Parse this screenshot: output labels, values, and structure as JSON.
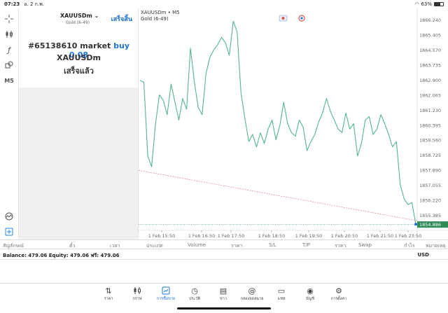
{
  "status": {
    "time": "07:23",
    "date": "อ. 2 ก.พ.",
    "battery": "63%",
    "battery_level": 0.63
  },
  "panel": {
    "symbol": "XAUUSDm",
    "symbol_desc": "Gold (6-49)",
    "done_label": "เสร็จสิ้น",
    "order_prefix": "#65138610 market",
    "order_side": "buy 0.08",
    "order_symbol": "XAUUSDm",
    "order_status": "เสร็จแล้ว"
  },
  "chart": {
    "header_symbol": "XAUUSDm • M5",
    "header_desc": "Gold (6-49)",
    "timeframe": "M5",
    "current_price": "1854.886",
    "colors": {
      "line": "#55b58b",
      "dashed": "#e07b7b",
      "price_badge": "#2e8b57"
    }
  },
  "chart_data": {
    "type": "line",
    "x_ticks": [
      "1 Feb 15:50",
      "1 Feb 16:50",
      "1 Feb 17:50",
      "1 Feb 18:50",
      "1 Feb 19:50",
      "1 Feb 20:50",
      "1 Feb 21:50",
      "1 Feb 23:50"
    ],
    "y_ticks": [
      "1866.240",
      "1865.405",
      "1864.570",
      "1863.735",
      "1862.900",
      "1862.065",
      "1861.230",
      "1860.395",
      "1859.560",
      "1858.725",
      "1857.890",
      "1857.055",
      "1856.220",
      "1855.385"
    ],
    "ylim": [
      1854.6,
      1866.6
    ],
    "series": [
      {
        "values": [
          1862.9,
          1862.8,
          1858.7,
          1858.1,
          1860.5,
          1862.1,
          1861.8,
          1861.0,
          1862.7,
          1861.7,
          1860.7,
          1861.9,
          1861.3,
          1864.7,
          1862.8,
          1861.4,
          1861.0,
          1863.3,
          1864.2,
          1864.6,
          1864.9,
          1865.3,
          1865.0,
          1864.3,
          1866.2,
          1865.6,
          1862.2,
          1860.8,
          1859.5,
          1859.9,
          1859.2,
          1860.0,
          1859.4,
          1860.2,
          1860.7,
          1859.6,
          1860.4,
          1861.7,
          1860.5,
          1860.0,
          1859.8,
          1860.7,
          1860.3,
          1859.0,
          1859.5,
          1859.9,
          1860.6,
          1861.1,
          1861.9,
          1861.2,
          1860.7,
          1860.2,
          1860.0,
          1861.1,
          1860.2,
          1860.5,
          1858.7,
          1859.4,
          1860.7,
          1860.9,
          1859.9,
          1860.2,
          1861.0,
          1860.5,
          1859.9,
          1859.2,
          1859.5,
          1857.1,
          1856.3,
          1856.0,
          1856.1,
          1854.9
        ]
      }
    ],
    "trend_line": {
      "start": 1857.9,
      "end": 1855.1
    },
    "current_price": 1854.886,
    "grid": false
  },
  "columns": [
    "สัญลักษณ์",
    "ตั๋ว",
    "เวลา",
    "ประเภท",
    "Volume",
    "ราคา",
    "S/L",
    "T/P",
    "ราคา",
    "Swap",
    "กำไร",
    "หมายเหตุ"
  ],
  "balance": {
    "text": "Balance: 479.06 Equity: 479.06 ฟรี: 479.06",
    "currency": "USD"
  },
  "tabs": [
    {
      "label": "ราคา",
      "icon": "quotes-icon"
    },
    {
      "label": "กราฟ",
      "icon": "chart-icon"
    },
    {
      "label": "การซื้อขาย",
      "icon": "trade-icon"
    },
    {
      "label": "ประวัติ",
      "icon": "history-icon"
    },
    {
      "label": "ข่าว",
      "icon": "news-icon"
    },
    {
      "label": "กล่องจดหมาย",
      "icon": "mailbox-icon"
    },
    {
      "label": "แชท",
      "icon": "chat-icon"
    },
    {
      "label": "บัญชี",
      "icon": "account-icon"
    },
    {
      "label": "การตั้งค่า",
      "icon": "settings-icon"
    }
  ],
  "active_tab": 2
}
